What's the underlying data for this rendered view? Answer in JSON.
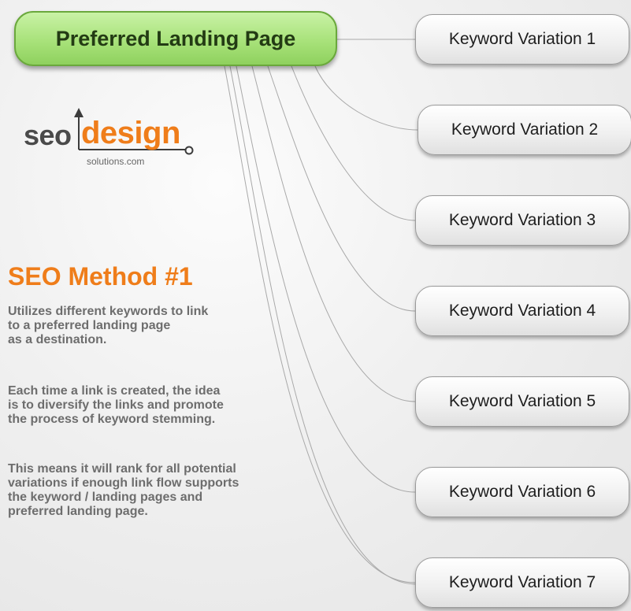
{
  "root": {
    "label": "Preferred Landing Page"
  },
  "keywords": [
    "Keyword Variation 1",
    "Keyword Variation 2",
    "Keyword Variation 3",
    "Keyword Variation 4",
    "Keyword Variation 5",
    "Keyword Variation 6",
    "Keyword Variation 7"
  ],
  "logo": {
    "seo": "seo",
    "design": "design",
    "domain": "solutions.com"
  },
  "method": {
    "title": "SEO Method #1",
    "paragraphs": [
      "Utilizes different keywords to link\nto a preferred landing page\nas a destination.",
      "Each time a link is created, the idea\nis to diversify the links  and promote\nthe process of keyword stemming.",
      "This means it will rank for all potential\nvariations if enough link flow supports\nthe keyword / landing pages and\npreferred landing page."
    ]
  },
  "colors": {
    "accent": "#ef7d1a",
    "root_fill": "#a8e27a",
    "root_border": "#6aa83c",
    "text_gray": "#6d6d6d"
  }
}
